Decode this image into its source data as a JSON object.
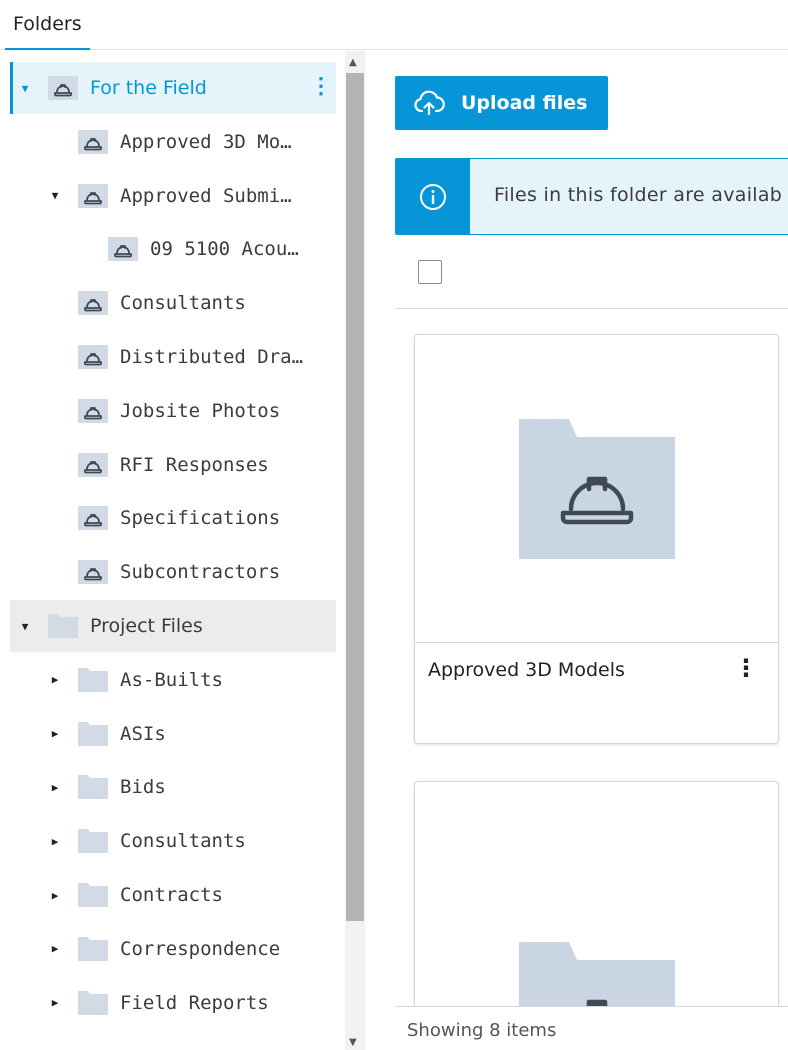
{
  "header": {
    "tab_label": "Folders"
  },
  "tree": {
    "rows": [
      {
        "label": "For the Field",
        "indent": 0,
        "caret": "open",
        "icon": "hardhat-folder-icon",
        "selected": true
      },
      {
        "label": "Approved 3D Mo…",
        "indent": 1,
        "caret": "none",
        "icon": "hardhat-folder-icon"
      },
      {
        "label": "Approved Submi…",
        "indent": 1,
        "caret": "open",
        "icon": "hardhat-folder-icon"
      },
      {
        "label": "09 5100 Acou…",
        "indent": 2,
        "caret": "none",
        "icon": "hardhat-folder-icon"
      },
      {
        "label": "Consultants",
        "indent": 1,
        "caret": "none",
        "icon": "hardhat-folder-icon"
      },
      {
        "label": "Distributed Dra…",
        "indent": 1,
        "caret": "none",
        "icon": "hardhat-folder-icon"
      },
      {
        "label": "Jobsite Photos",
        "indent": 1,
        "caret": "none",
        "icon": "hardhat-folder-icon"
      },
      {
        "label": "RFI Responses",
        "indent": 1,
        "caret": "none",
        "icon": "hardhat-folder-icon"
      },
      {
        "label": "Specifications",
        "indent": 1,
        "caret": "none",
        "icon": "hardhat-folder-icon"
      },
      {
        "label": "Subcontractors",
        "indent": 1,
        "caret": "none",
        "icon": "hardhat-folder-icon"
      },
      {
        "label": "Project Files",
        "indent": 0,
        "caret": "open",
        "icon": "folder-icon",
        "project": true
      },
      {
        "label": "As-Builts",
        "indent": 1,
        "caret": "closed",
        "icon": "folder-icon"
      },
      {
        "label": "ASIs",
        "indent": 1,
        "caret": "closed",
        "icon": "folder-icon"
      },
      {
        "label": "Bids",
        "indent": 1,
        "caret": "closed",
        "icon": "folder-icon"
      },
      {
        "label": "Consultants",
        "indent": 1,
        "caret": "closed",
        "icon": "folder-icon"
      },
      {
        "label": "Contracts",
        "indent": 1,
        "caret": "closed",
        "icon": "folder-icon"
      },
      {
        "label": "Correspondence",
        "indent": 1,
        "caret": "closed",
        "icon": "folder-icon"
      },
      {
        "label": "Field Reports",
        "indent": 1,
        "caret": "closed",
        "icon": "folder-icon"
      }
    ]
  },
  "main": {
    "upload_label": "Upload files",
    "info_text": "Files in this folder are availab",
    "cards": [
      {
        "title": "Approved 3D Models"
      },
      {
        "title": ""
      }
    ],
    "status": "Showing 8 items"
  },
  "colors": {
    "accent": "#0696d7",
    "selected_bg": "#e5f3fb",
    "folder": "#c9d5e2",
    "hardhat": "#3f4a52"
  }
}
